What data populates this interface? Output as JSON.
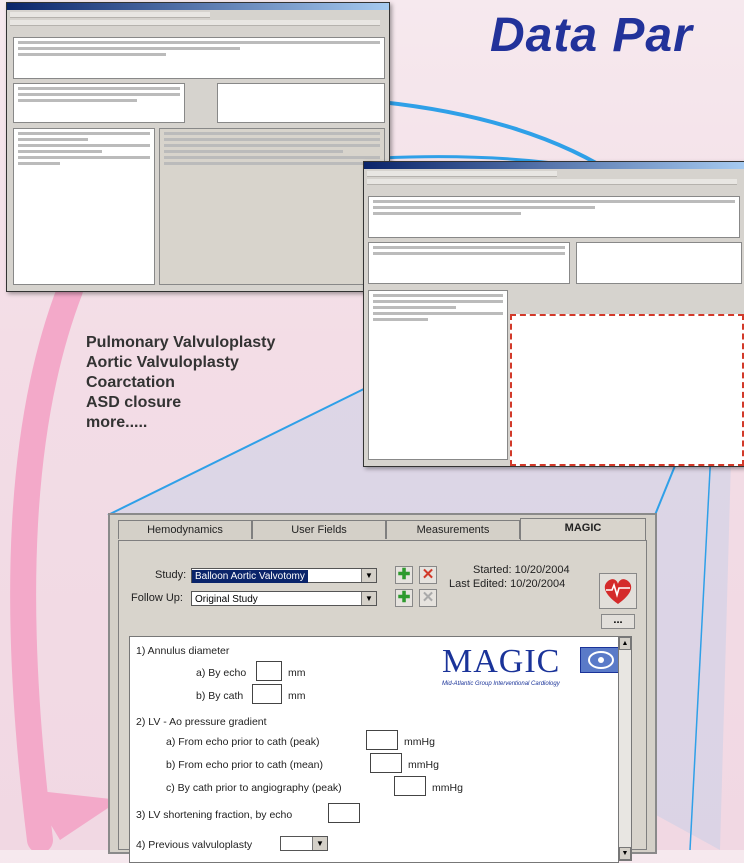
{
  "poster": {
    "title": "Data Par",
    "procedures": [
      "Pulmonary Valvuloplasty",
      "Aortic Valvuloplasty",
      "Coarctation",
      "ASD closure",
      "more....."
    ]
  },
  "colors": {
    "title": "#22329a",
    "arrow_pink": "#f0a8c8",
    "callout_blue": "#2fa0e8",
    "selection_blue": "#0a246a"
  },
  "panel": {
    "tabs": [
      {
        "label": "Hemodynamics",
        "active": false
      },
      {
        "label": "User Fields",
        "active": false
      },
      {
        "label": "Measurements",
        "active": false
      },
      {
        "label": "MAGIC",
        "active": true
      }
    ],
    "study_label": "Study:",
    "study_value": "Balloon Aortic Valvotomy",
    "followup_label": "Follow Up:",
    "followup_value": "Original Study",
    "started": "Started: 10/20/2004",
    "last_edited": "Last Edited: 10/20/2004",
    "more_button": "...",
    "add_icon": "plus-icon",
    "remove_icon": "x-icon",
    "heart_icon": "heart-icon",
    "logo_word": "MAGIC",
    "logo_sub": "Mid-Atlantic Group Interventional Cardiology",
    "questions": [
      {
        "n": "1) Annulus diameter"
      },
      {
        "a": "a) By echo",
        "unit": "mm"
      },
      {
        "b": "b) By cath",
        "unit": "mm"
      },
      {
        "n": "2) LV - Ao pressure gradient"
      },
      {
        "a": "a) From echo prior to cath (peak)",
        "unit": "mmHg"
      },
      {
        "b": "b) From echo prior to cath (mean)",
        "unit": "mmHg"
      },
      {
        "c": "c) By cath prior to angiography (peak)",
        "unit": "mmHg"
      },
      {
        "n": "3) LV shortening fraction, by echo"
      },
      {
        "n": "4) Previous valvuloplasty"
      }
    ]
  }
}
